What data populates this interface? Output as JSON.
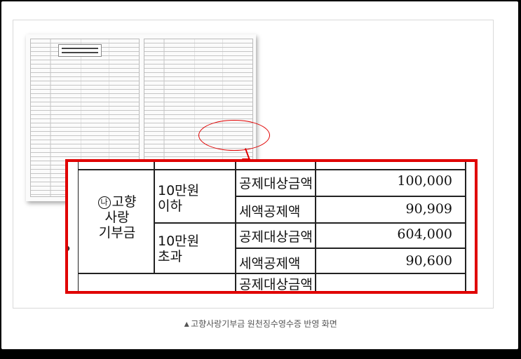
{
  "zoom_table": {
    "category": "고향\n사랑\n기부금",
    "category_prefix": "나",
    "groups": [
      {
        "range": "10만원\n이하",
        "rows": [
          {
            "item": "공제대상금액",
            "amount": "100,000"
          },
          {
            "item": "세액공제액",
            "amount": "90,909"
          }
        ]
      },
      {
        "range": "10만원\n초과",
        "rows": [
          {
            "item": "공제대상금액",
            "amount": "604,000"
          },
          {
            "item": "세액공제액",
            "amount": "90,600"
          }
        ]
      }
    ],
    "cut_off_row": "공제대상금액"
  },
  "caption": "▲고향사랑기부금 원천징수영수증 반영 화면",
  "colors": {
    "highlight": "#e00000"
  }
}
